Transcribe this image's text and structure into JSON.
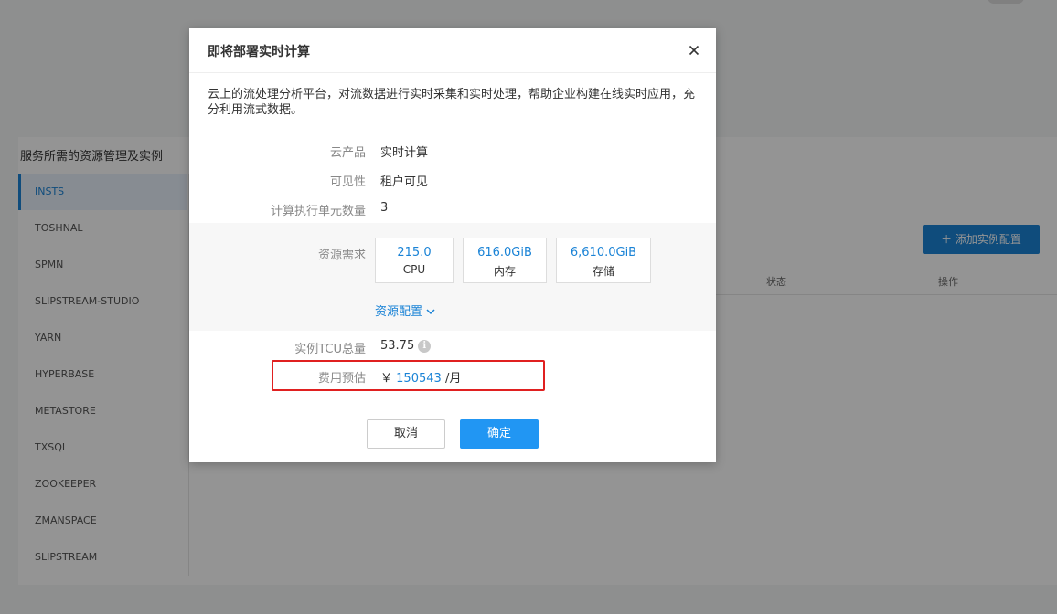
{
  "background": {
    "section_title": "服务所需的资源管理及实例",
    "sidebar": [
      {
        "label": "INSTS",
        "active": true
      },
      {
        "label": "TOSHNAL",
        "active": false
      },
      {
        "label": "SPMN",
        "active": false
      },
      {
        "label": "SLIPSTREAM-STUDIO",
        "active": false
      },
      {
        "label": "YARN",
        "active": false
      },
      {
        "label": "HYPERBASE",
        "active": false
      },
      {
        "label": "METASTORE",
        "active": false
      },
      {
        "label": "TXSQL",
        "active": false
      },
      {
        "label": "ZOOKEEPER",
        "active": false
      },
      {
        "label": "ZMANSPACE",
        "active": false
      },
      {
        "label": "SLIPSTREAM",
        "active": false
      }
    ],
    "add_button": "添加实例配置",
    "table_columns": [
      "状态",
      "操作"
    ]
  },
  "dialog": {
    "title": "即将部署实时计算",
    "description": "云上的流处理分析平台，对流数据进行实时采集和实时处理，帮助企业构建在线实时应用，充分利用流式数据。",
    "product": {
      "label": "云产品",
      "value": "实时计算"
    },
    "visibility": {
      "label": "可见性",
      "value": "租户可见"
    },
    "units": {
      "label": "计算执行单元数量",
      "value": "3"
    },
    "resources": {
      "label": "资源需求",
      "cpu": {
        "value": "215.0",
        "unit": "CPU"
      },
      "memory": {
        "value": "616.0GiB",
        "unit": "内存"
      },
      "storage": {
        "value": "6,610.0GiB",
        "unit": "存储"
      },
      "config_link": "资源配置"
    },
    "tcu": {
      "label": "实例TCU总量",
      "value": "53.75"
    },
    "cost": {
      "label": "费用预估",
      "currency": "￥",
      "amount": "150543",
      "period": "/月"
    },
    "cancel_label": "取消",
    "ok_label": "确定"
  },
  "colors": {
    "accent": "#1a83d6",
    "primary_button": "#2196f3",
    "highlight": "#e02020"
  },
  "icons": {
    "close": "close-icon",
    "chevron": "chevron-down-icon",
    "info": "info-icon"
  }
}
